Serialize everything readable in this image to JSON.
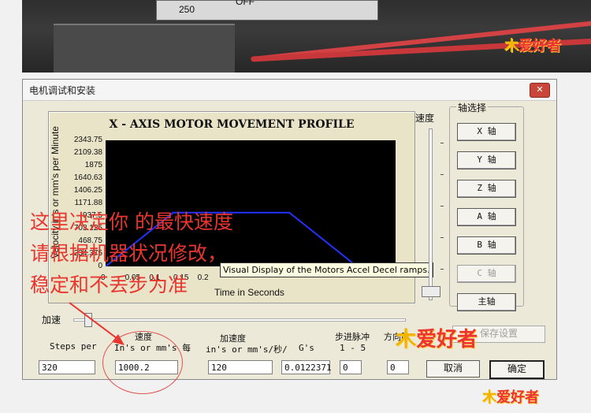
{
  "photo": {
    "panel_values": [
      "250",
      "OFF"
    ]
  },
  "watermark": {
    "brand": "爱好者"
  },
  "dialog": {
    "title": "电机调试和安装",
    "close_glyph": "✕",
    "chart": {
      "tooltip": "Visual Display of the Motors Accel  Decel ramps."
    },
    "speed_label": "速度",
    "axis_group": {
      "legend": "轴选择",
      "buttons": [
        "X 轴",
        "Y 轴",
        "Z 轴",
        "A 轴",
        "B 轴",
        "C 轴",
        "主轴"
      ]
    },
    "accel_label": "加速",
    "fields": {
      "steps_per": {
        "label": "Steps per",
        "value": "320"
      },
      "velocity": {
        "label_top": "速度",
        "label": "In's or mm's 每",
        "value": "1000.2"
      },
      "acceleration": {
        "label_top": "加速度",
        "label": "in's or mm's/秒/",
        "value": "120"
      },
      "g": {
        "label": "G's",
        "value": "0.0122371"
      },
      "step_pulse": {
        "label_top": "步进脉冲",
        "label": "1 - 5",
        "value": "0"
      },
      "dir_pulse": {
        "label_top": "方向脉",
        "value": "0"
      }
    },
    "buttons": {
      "save": "保存设置",
      "cancel": "取消",
      "ok": "确定"
    }
  },
  "annotation": {
    "lines": [
      "这里决定你 的最快速度",
      "请根据机器状况修改，",
      "稳定和不丢步为准"
    ]
  },
  "chart_data": {
    "type": "line",
    "title": "X - AXIS MOTOR MOVEMENT PROFILE",
    "xlabel": "Time in Seconds",
    "ylabel": "Velocity in's or mm's per Minute",
    "y_ticks": [
      "2343.75",
      "2109.38",
      "1875",
      "1640.63",
      "1406.25",
      "1171.88",
      "937.5",
      "703.125",
      "468.75",
      "234.375",
      "0"
    ],
    "x_ticks": [
      "0",
      "0.05",
      "0.1",
      "0.15",
      "0.2"
    ],
    "ylim": [
      0,
      2343.75
    ],
    "xlim": [
      0,
      0.6
    ],
    "series": [
      {
        "color": "#2233ff",
        "x": [
          0,
          0.14,
          0.38,
          0.52,
          0.6
        ],
        "y": [
          0,
          1000.2,
          1000.2,
          0,
          0
        ]
      }
    ],
    "grid": false,
    "background": "#000000"
  }
}
